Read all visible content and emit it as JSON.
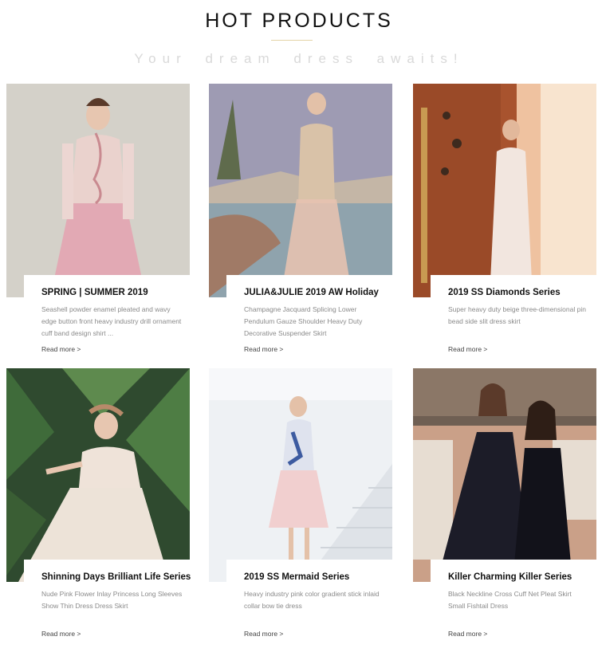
{
  "header": {
    "title": "HOT PRODUCTS",
    "subtitle": "Your dream  dress awaits!"
  },
  "products": [
    {
      "title": "SPRING | SUMMER 2019",
      "description": "Seashell powder enamel pleated and wavy edge button front heavy industry drill ornament cuff band design shirt ...",
      "link": "Read more >"
    },
    {
      "title": "JULIA&JULIE 2019 AW Holiday",
      "description": "Champagne Jacquard Splicing Lower Pendulum Gauze Shoulder Heavy Duty Decorative Suspender Skirt",
      "link": "Read more >"
    },
    {
      "title": "2019 SS Diamonds Series",
      "description": "Super heavy duty beige three-dimensional pin bead side slit dress skirt",
      "link": "Read more >"
    },
    {
      "title": "Shinning Days Brilliant Life Series",
      "description": "Nude Pink Flower Inlay Princess Long Sleeves Show Thin Dress Dress Skirt",
      "link": "Read more >"
    },
    {
      "title": "2019 SS Mermaid Series",
      "description": "Heavy industry pink color gradient stick inlaid collar bow tie dress",
      "link": "Read more >"
    },
    {
      "title": "Killer Charming Killer Series",
      "description": "Black Neckline Cross Cuff Net Pleat Skirt Small Fishtail Dress",
      "link": "Read more >"
    }
  ]
}
